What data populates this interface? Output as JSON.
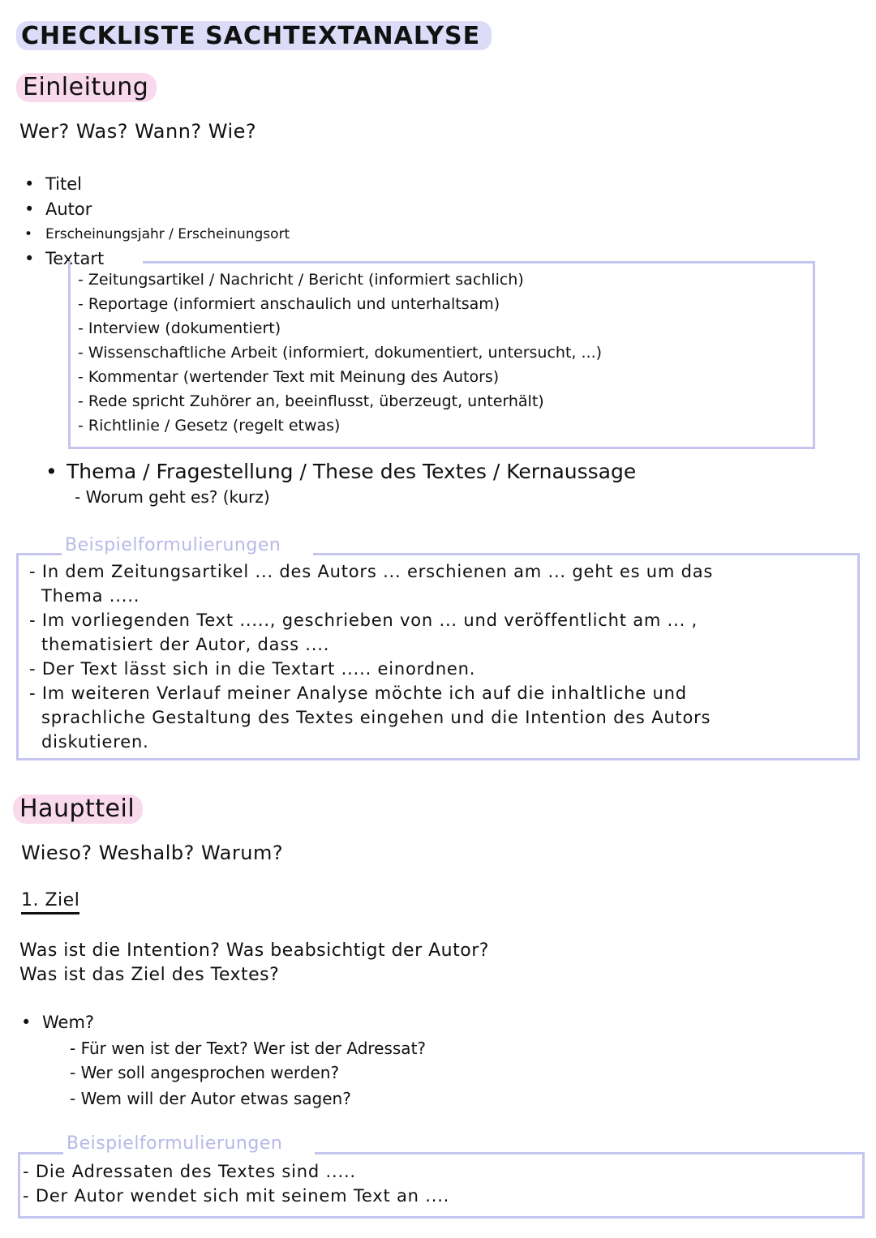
{
  "title": "CHECKLISTE SACHTEXTANALYSE",
  "colors": {
    "title_highlight": "#dcdcf8",
    "section_highlight": "#f9d9ec",
    "box_border": "#c5c5f0",
    "example_label": "#b8b8ea"
  },
  "einleitung": {
    "heading": "Einleitung",
    "questions": "Wer? Was? Wann? Wie?",
    "bullets": [
      "Titel",
      "Autor",
      "Erscheinungsjahr / Erscheinungsort",
      "Textart"
    ],
    "textarten": [
      "- Zeitungsartikel / Nachricht / Bericht (informiert sachlich)",
      "- Reportage (informiert anschaulich und unterhaltsam)",
      "- Interview (dokumentiert)",
      "- Wissenschaftliche Arbeit (informiert, dokumentiert, untersucht, ...)",
      "- Kommentar (wertender Text mit Meinung des Autors)",
      "- Rede spricht Zuhörer an, beeinflusst, überzeugt, unterhält)",
      "- Richtlinie / Gesetz (regelt etwas)"
    ],
    "thema_bullet": "Thema / Fragestellung / These des Textes / Kernaussage",
    "thema_sub": "- Worum geht es? (kurz)",
    "examples_label": "Beispielformulierungen",
    "examples": [
      "- In dem Zeitungsartikel ... des Autors ... erschienen am ... geht es um das",
      "  Thema .....",
      "- Im vorliegenden Text ....., geschrieben von ... und veröffentlicht am ... ,",
      "  thematisiert der Autor, dass ....",
      "- Der Text lässt sich in die Textart ..... einordnen.",
      "- Im weiteren Verlauf meiner Analyse möchte ich auf die inhaltliche und",
      "  sprachliche Gestaltung des Textes eingehen und die Intention des Autors",
      "  diskutieren."
    ]
  },
  "hauptteil": {
    "heading": "Hauptteil",
    "questions": "Wieso? Weshalb? Warum?",
    "subheading": "1. Ziel",
    "ziel_questions": [
      "Was ist die Intention? Was beabsichtigt der Autor?",
      "Was ist das Ziel des Textes?"
    ],
    "wem_bullet": "Wem?",
    "wem_sub": [
      "- Für wen ist der Text? Wer ist der Adressat?",
      "- Wer soll angesprochen werden?",
      "- Wem will der Autor etwas sagen?"
    ],
    "examples_label": "Beispielformulierungen",
    "examples": [
      "- Die Adressaten des Textes sind .....",
      "- Der Autor wendet sich mit seinem Text an ...."
    ]
  }
}
